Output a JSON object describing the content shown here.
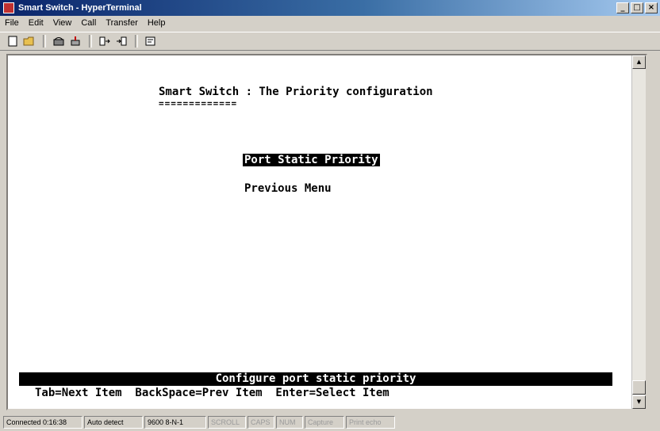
{
  "window": {
    "title": "Smart Switch - HyperTerminal",
    "buttons": [
      "_",
      "□",
      "×"
    ]
  },
  "menubar": [
    "File",
    "Edit",
    "View",
    "Call",
    "Transfer",
    "Help"
  ],
  "terminal": {
    "heading": "Smart Switch : The Priority configuration",
    "underline": "=============",
    "menu": {
      "selected": "Port Static Priority",
      "option": "Previous Menu"
    },
    "help_text": "Configure port static priority",
    "keys": "Tab=Next Item  BackSpace=Prev Item  Enter=Select Item"
  },
  "status": {
    "connected": "Connected 0:16:38",
    "detect": "Auto detect",
    "settings": "9600 8-N-1",
    "scroll": "SCROLL",
    "caps": "CAPS",
    "num": "NUM",
    "capture": "Capture",
    "print_echo": "Print echo"
  }
}
